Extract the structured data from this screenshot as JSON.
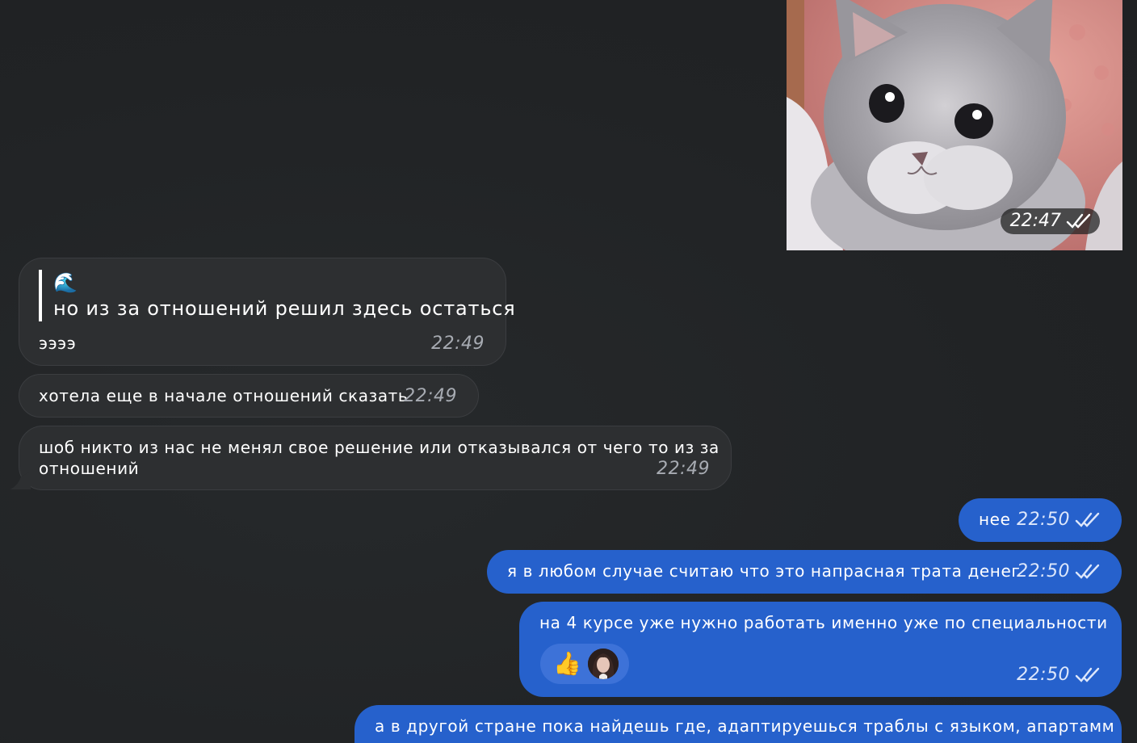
{
  "photo_message": {
    "time": "22:47",
    "status_icon": "double-check-icon"
  },
  "quoted_message": {
    "quote_emoji": "🌊",
    "quote_text": "но из за отношений решил здесь остаться",
    "text": "ээээ",
    "time": "22:49"
  },
  "incoming_messages": [
    {
      "text": "хотела еще в начале отношений сказать",
      "time": "22:49"
    },
    {
      "line1": "шоб никто из нас не менял свое решение или отказывался от чего то из за",
      "line2": "отношений",
      "time": "22:49"
    }
  ],
  "outgoing_messages": [
    {
      "text": "нее",
      "time": "22:50",
      "status_icon": "double-check-icon"
    },
    {
      "text": "я в любом случае считаю что это напрасная трата денег",
      "time": "22:50",
      "status_icon": "double-check-icon"
    },
    {
      "text": "на 4 курсе уже нужно работать именно уже по специальности",
      "time": "22:50",
      "status_icon": "double-check-icon",
      "reactions": [
        "👍",
        "avatar"
      ]
    },
    {
      "text": "а в другой стране пока найдешь где, адаптируешься траблы с языком, апартамм"
    }
  ],
  "colors": {
    "background": "#212325",
    "incoming_bubble": "#2d2f31",
    "outgoing_bubble": "#2661cc"
  }
}
